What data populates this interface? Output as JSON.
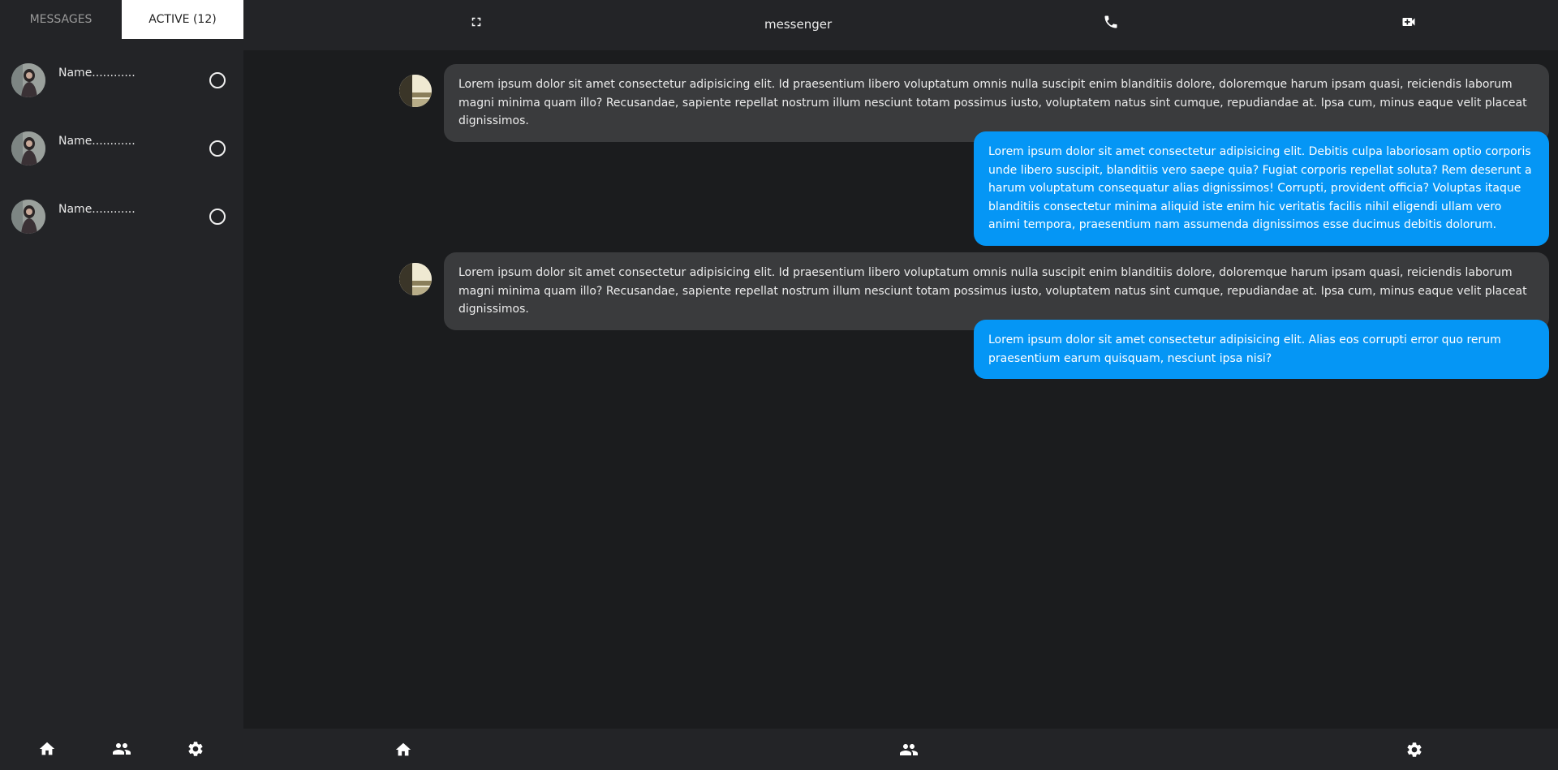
{
  "sidebar": {
    "tabs": [
      {
        "label": "MESSAGES"
      },
      {
        "label": "ACTIVE (12)"
      }
    ],
    "contacts": [
      {
        "name": "Name............"
      },
      {
        "name": "Name............"
      },
      {
        "name": "Name............"
      }
    ],
    "nav_icons": [
      "home-icon",
      "people-icon",
      "settings-icon"
    ]
  },
  "header": {
    "title": "messenger",
    "icons": [
      "fullscreen-icon",
      "phone-icon",
      "video-call-icon"
    ]
  },
  "messages": [
    {
      "direction": "in",
      "text": "Lorem ipsum dolor sit amet consectetur adipisicing elit. Id praesentium libero voluptatum omnis nulla suscipit enim blanditiis dolore, doloremque harum ipsam quasi, reiciendis laborum magni minima quam illo? Recusandae, sapiente repellat nostrum illum nesciunt totam possimus iusto, voluptatem natus sint cumque, repudiandae at. Ipsa cum, minus eaque velit placeat dignissimos."
    },
    {
      "direction": "out",
      "text": "Lorem ipsum dolor sit amet consectetur adipisicing elit. Debitis culpa laboriosam optio corporis unde libero suscipit, blanditiis vero saepe quia? Fugiat corporis repellat soluta? Rem deserunt a harum voluptatum consequatur alias dignissimos! Corrupti, provident officia? Voluptas itaque blanditiis consectetur minima aliquid iste enim hic veritatis facilis nihil eligendi ullam vero animi tempora, praesentium nam assumenda dignissimos esse ducimus debitis dolorum."
    },
    {
      "direction": "in",
      "text": "Lorem ipsum dolor sit amet consectetur adipisicing elit. Id praesentium libero voluptatum omnis nulla suscipit enim blanditiis dolore, doloremque harum ipsam quasi, reiciendis laborum magni minima quam illo? Recusandae, sapiente repellat nostrum illum nesciunt totam possimus iusto, voluptatem natus sint cumque, repudiandae at. Ipsa cum, minus eaque velit placeat dignissimos."
    },
    {
      "direction": "out",
      "text": "Lorem ipsum dolor sit amet consectetur adipisicing elit. Alias eos corrupti error quo rerum praesentium earum quisquam, nesciunt ipsa nisi?"
    }
  ],
  "bottom_nav": [
    "home-icon",
    "people-icon",
    "settings-icon"
  ],
  "colors": {
    "background": "#1b1c1e",
    "panel": "#232427",
    "incoming_bubble": "#3a3b3d",
    "outgoing_bubble": "#0596f5",
    "active_tab": "#ffffff"
  }
}
